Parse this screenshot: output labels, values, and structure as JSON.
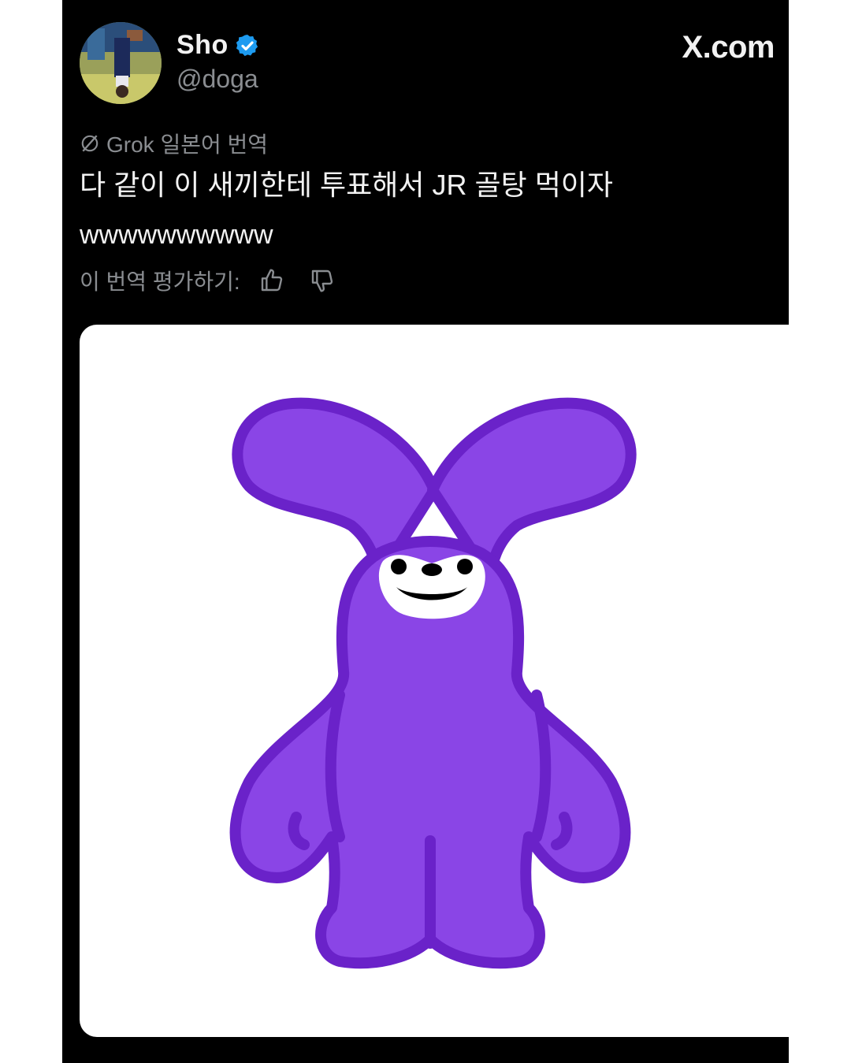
{
  "post": {
    "brand": "X.com",
    "author": {
      "display_name": "Sho",
      "handle": "@doga",
      "verified": true,
      "verified_color": "#1d9bf0"
    },
    "translation_label": "Grok 일본어 번역",
    "text_line1": "다 같이 이 새끼한테 투표해서 JR 골탕 먹이자",
    "text_line2": "wwwwwwwwww",
    "rate_label": "이 번역 평가하기:",
    "rate_icons": [
      "thumbs-up-icon",
      "thumbs-down-icon"
    ],
    "media": {
      "type": "image",
      "subject": "purple-rabbit-character",
      "fill_color": "#8a45e6",
      "outline_color": "#6a22c9"
    }
  }
}
